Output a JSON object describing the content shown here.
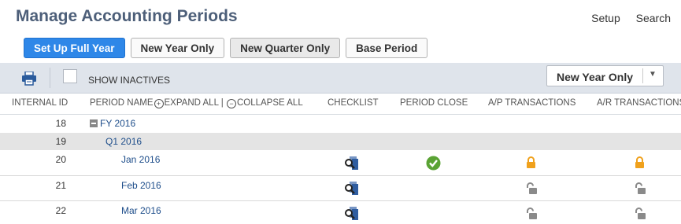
{
  "header": {
    "title": "Manage Accounting Periods",
    "links": [
      "Setup",
      "Search"
    ]
  },
  "buttons": [
    "Set Up Full Year",
    "New Year Only",
    "New Quarter Only",
    "Base Period"
  ],
  "toolbar": {
    "show_inactives_label": "SHOW INACTIVES",
    "show_inactives_checked": false,
    "filter_value": "New Year Only"
  },
  "table": {
    "columns": {
      "internal_id": "INTERNAL ID",
      "period_name": "PERIOD NAME",
      "expand_all": "EXPAND ALL",
      "separator": "|",
      "collapse_all": "COLLAPSE ALL",
      "checklist": "CHECKLIST",
      "period_close": "PERIOD CLOSE",
      "ap": "A/P TRANSACTIONS",
      "ar": "A/R TRANSACTIONS"
    },
    "rows": [
      {
        "id": "18",
        "name": "FY 2016",
        "level": 0,
        "collapsible": true
      },
      {
        "id": "19",
        "name": "Q1 2016",
        "level": 1
      },
      {
        "id": "20",
        "name": "Jan 2016",
        "level": 2,
        "checklist": "search-icon",
        "period_close": "check-icon",
        "ap": "locked",
        "ar": "locked"
      },
      {
        "id": "21",
        "name": "Feb 2016",
        "level": 2,
        "checklist": "search-icon",
        "ap": "unlocked",
        "ar": "unlocked"
      },
      {
        "id": "22",
        "name": "Mar 2016",
        "level": 2,
        "checklist": "search-icon",
        "ap": "unlocked",
        "ar": "unlocked"
      }
    ]
  },
  "colors": {
    "accent": "#2e87e8",
    "title": "#4d5f79",
    "link": "#1d4d8a",
    "lock_closed": "#f0a11c",
    "lock_open": "#8a8a8a",
    "check": "#5aa334",
    "toolbar_bg": "#dfe4eb",
    "row_highlight": "#e4e4e4"
  }
}
